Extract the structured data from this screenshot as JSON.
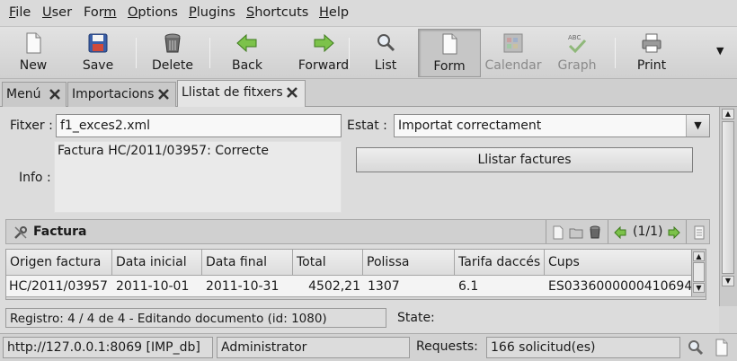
{
  "menubar": {
    "items": [
      {
        "pre": "",
        "ul": "F",
        "post": "ile"
      },
      {
        "pre": "",
        "ul": "U",
        "post": "ser"
      },
      {
        "pre": "For",
        "ul": "m",
        "post": ""
      },
      {
        "pre": "",
        "ul": "O",
        "post": "ptions"
      },
      {
        "pre": "",
        "ul": "P",
        "post": "lugins"
      },
      {
        "pre": "",
        "ul": "S",
        "post": "hortcuts"
      },
      {
        "pre": "",
        "ul": "H",
        "post": "elp"
      }
    ]
  },
  "toolbar": {
    "new_label": "New",
    "save_label": "Save",
    "delete_label": "Delete",
    "back_label": "Back",
    "forward_label": "Forward",
    "list_label": "List",
    "form_label": "Form",
    "calendar_label": "Calendar",
    "graph_label": "Graph",
    "graph_icon_text": "ABC",
    "print_label": "Print"
  },
  "tabs": [
    {
      "label": "Menú"
    },
    {
      "label": "Importacions"
    },
    {
      "label": "Llistat de fitxers"
    }
  ],
  "form": {
    "fitxer_label": "Fitxer :",
    "fitxer_value": "f1_exces2.xml",
    "estat_label": "Estat :",
    "estat_value": "Importat correctament",
    "info_label": "Info :",
    "info_value": "Factura HC/2011/03957: Correcte",
    "llistar_button": "Llistar factures"
  },
  "subform": {
    "title": "Factura",
    "pager": "(1/1)"
  },
  "table": {
    "columns": [
      "Origen factura",
      "Data inicial",
      "Data final",
      "Total",
      "Polissa",
      "Tarifa daccés",
      "Cups"
    ],
    "rows": [
      [
        "HC/2011/03957",
        "2011-10-01",
        "2011-10-31",
        "4502,21",
        "1307",
        "6.1",
        "ES0336000000410694"
      ]
    ]
  },
  "record_status": {
    "registro": "Registro: 4 / 4 de 4 - Editando documento (id: 1080)",
    "state_label": "State:"
  },
  "statusbar": {
    "server": "http://127.0.0.1:8069 [IMP_db]",
    "user": "Administrator",
    "requests_label": "Requests:",
    "requests_value": "166 solicitud(es)"
  }
}
